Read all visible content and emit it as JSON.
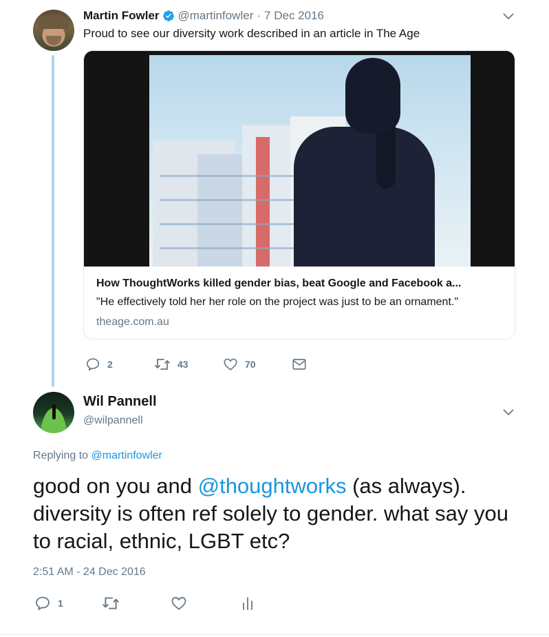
{
  "original_tweet": {
    "author_name": "Martin Fowler",
    "author_handle": "@martinfowler",
    "separator": "·",
    "date": "7 Dec 2016",
    "text": "Proud to see our diversity work described in an article in The Age",
    "card": {
      "title": "How ThoughtWorks killed gender bias, beat Google and Facebook a...",
      "description": "\"He effectively told her her role on the project was just to be an ornament.\"",
      "domain": "theage.com.au"
    },
    "actions": {
      "replies": "2",
      "retweets": "43",
      "likes": "70"
    }
  },
  "reply_tweet": {
    "author_name": "Wil Pannell",
    "author_handle": "@wilpannell",
    "replying_to_prefix": "Replying to",
    "replying_to_handle": "@martinfowler",
    "text_part1": "good on you and ",
    "text_mention": "@thoughtworks",
    "text_part2": " (as always). diversity is often ref solely to gender. what say you to racial, ethnic, LGBT etc?",
    "timestamp": "2:51 AM - 24 Dec 2016",
    "actions": {
      "replies": "1"
    }
  },
  "colors": {
    "accent": "#1b95e0",
    "muted": "#657786",
    "thread_line": "#a9d4ee",
    "verified": "#1da1f2"
  },
  "icons": [
    "verified-badge-icon",
    "chevron-down-icon",
    "reply-icon",
    "retweet-icon",
    "like-icon",
    "direct-message-icon",
    "analytics-icon"
  ]
}
